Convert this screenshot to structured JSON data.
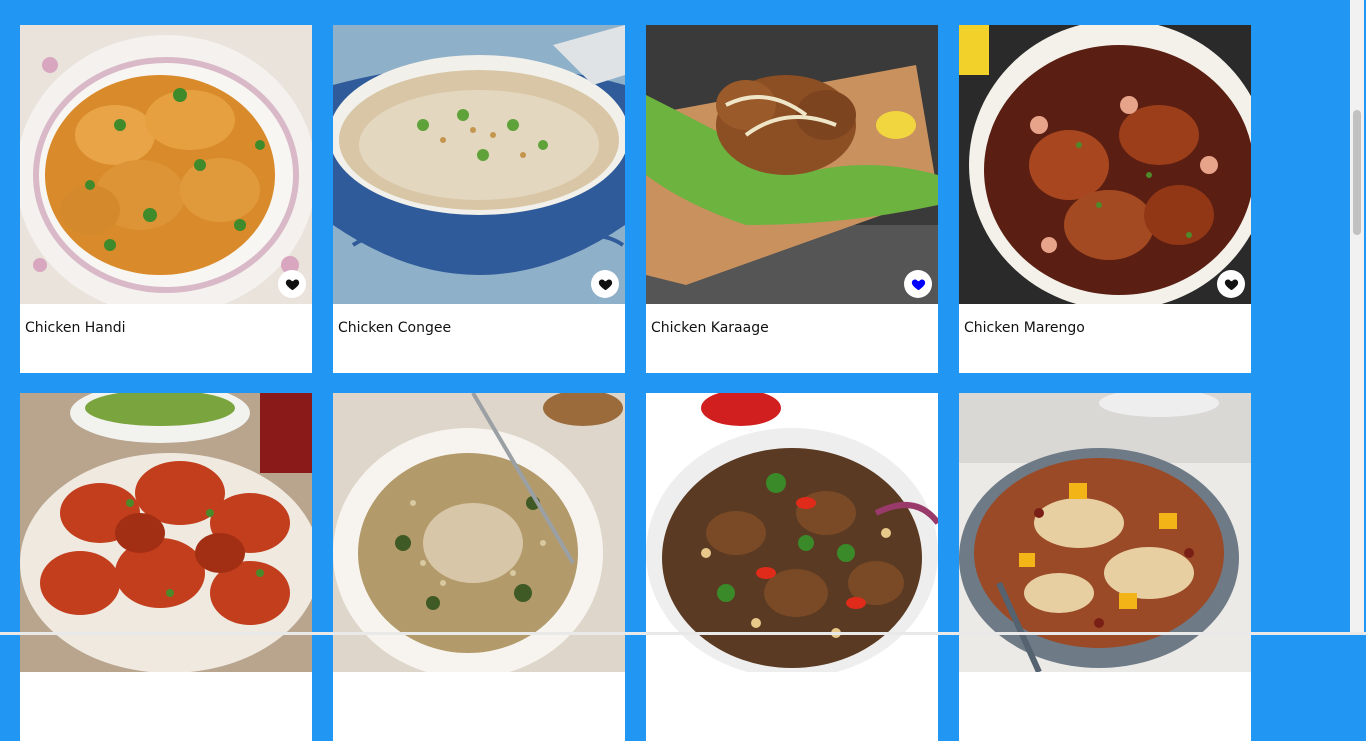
{
  "recipes": [
    {
      "title": "Chicken Handi",
      "favorited": false
    },
    {
      "title": "Chicken Congee",
      "favorited": false
    },
    {
      "title": "Chicken Karaage",
      "favorited": true
    },
    {
      "title": "Chicken Marengo",
      "favorited": false
    },
    {
      "title": "",
      "favorited": false
    },
    {
      "title": "",
      "favorited": false
    },
    {
      "title": "",
      "favorited": false
    },
    {
      "title": "",
      "favorited": false
    }
  ],
  "icons": {
    "favorite": "heart-icon"
  },
  "colors": {
    "background": "#2196f3",
    "heart_default": "#111111",
    "heart_active": "#0000ff",
    "card": "#ffffff"
  }
}
